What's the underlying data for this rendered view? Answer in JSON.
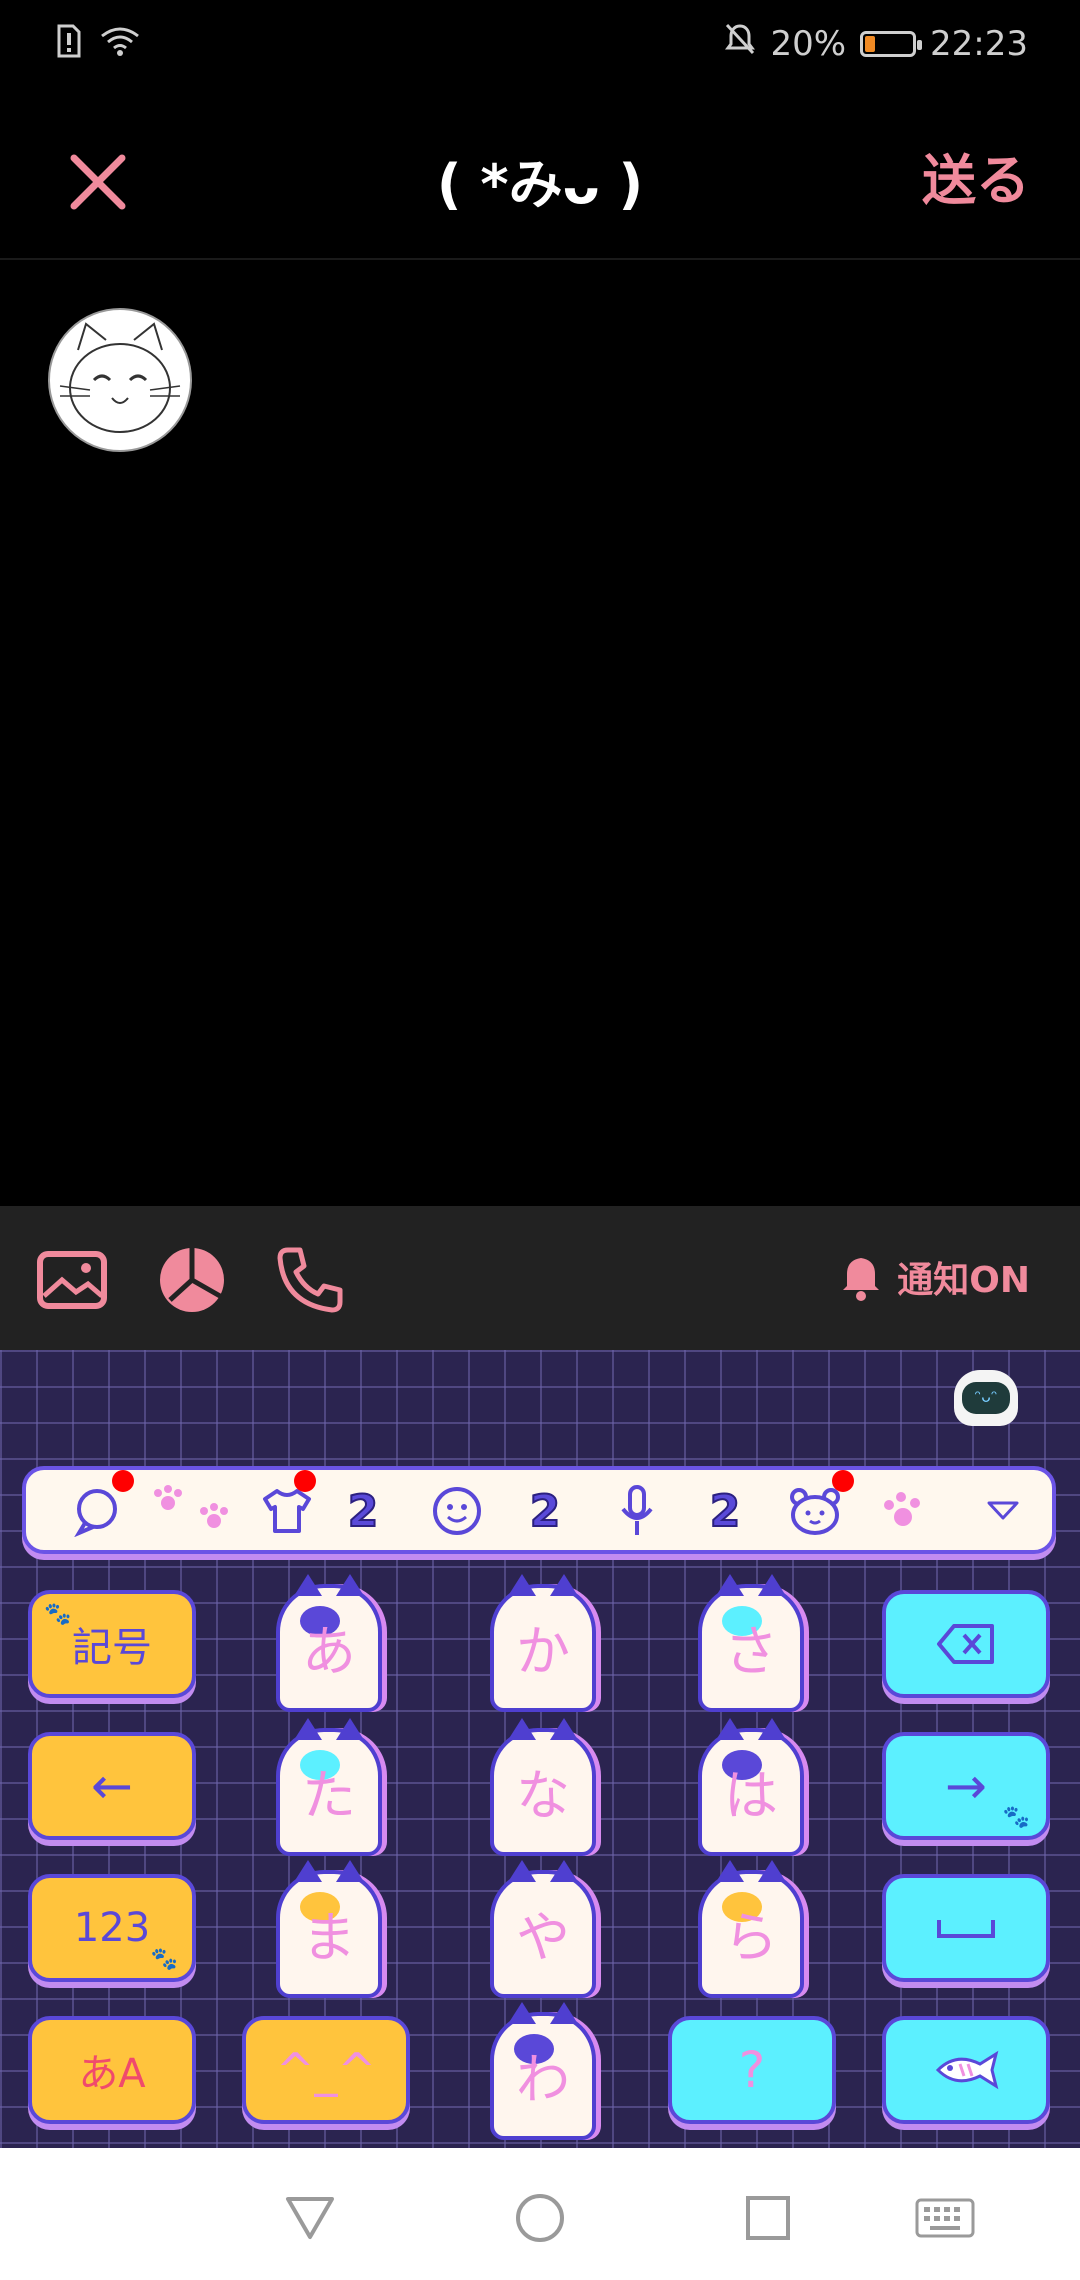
{
  "status_bar": {
    "battery_percent": "20%",
    "time": "22:23",
    "battery_level": 0.2
  },
  "header": {
    "title": "( *みᴗ )",
    "send_label": "送る"
  },
  "toolbar": {
    "notify_label": "通知ON"
  },
  "emoji_bar": {
    "counts": [
      "2",
      "2",
      "2"
    ]
  },
  "keyboard": {
    "left_keys": [
      "記号",
      "←",
      "123",
      "あA"
    ],
    "right_keys": [
      "⌫",
      "→",
      "␣",
      "fish"
    ],
    "cat_rows": [
      [
        "あ",
        "か",
        "さ"
      ],
      [
        "た",
        "な",
        "は"
      ],
      [
        "ま",
        "や",
        "ら"
      ]
    ],
    "bottom_middle": {
      "emoticon": "^_^",
      "wa": "わ",
      "punct": "?"
    },
    "colors": {
      "yellow": "#ffc43d",
      "cyan": "#5cf0ff",
      "border": "#5a48d8"
    }
  }
}
